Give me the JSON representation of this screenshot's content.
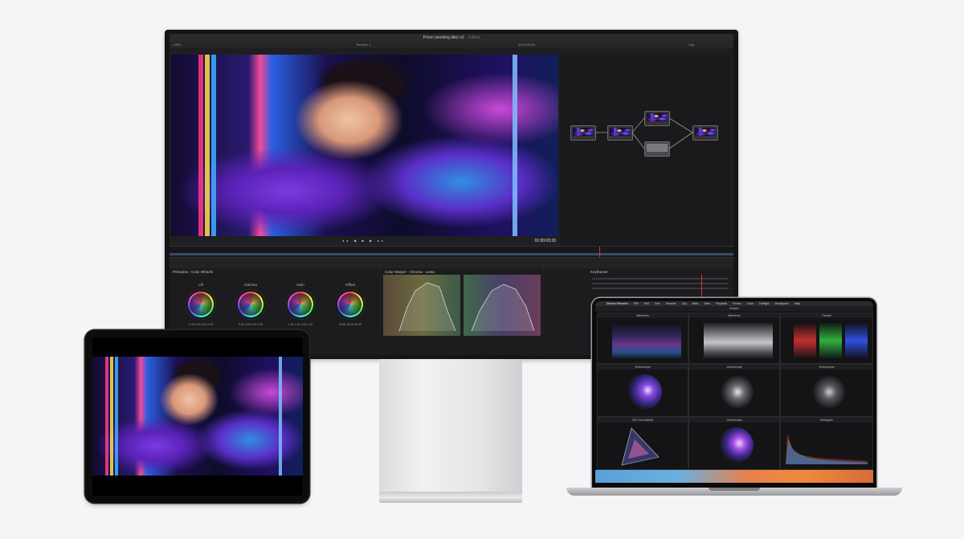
{
  "monitor": {
    "title": "Prism (working title) v3",
    "title_suffix": "Edited",
    "top_left": "CAPs",
    "timeline_label": "Timeline 1",
    "timecode": "00:00:00:00",
    "clip_label": "Clip",
    "playhead_timecode": "01:00:03:20",
    "color_wheels_title": "Primaries - Color Wheels",
    "wheels": [
      {
        "label": "Lift",
        "values": "0.00  0.00  0.00  0.00"
      },
      {
        "label": "Gamma",
        "values": "0.00  0.00  0.00  0.00"
      },
      {
        "label": "Gain",
        "values": "1.00  1.00  1.00  1.00"
      },
      {
        "label": "Offset",
        "values": "25.00  25.00  25.00"
      }
    ],
    "curves_title": "Color Warper - Chroma - Luma",
    "keyframes_title": "Keyframes"
  },
  "laptop": {
    "menu": [
      "DaVinci Resolve",
      "File",
      "Edit",
      "Trim",
      "Timeline",
      "Clip",
      "Mark",
      "View",
      "Playback",
      "Fusion",
      "Color",
      "Fairlight",
      "Workspace",
      "Help"
    ],
    "center_title": "Scopes",
    "panels": [
      {
        "title": "Waveform"
      },
      {
        "title": "Waveform"
      },
      {
        "title": "Parade"
      },
      {
        "title": "Vectorscope"
      },
      {
        "title": "Vectorscope"
      },
      {
        "title": "Vectorscope"
      },
      {
        "title": "CIE Chromaticity"
      },
      {
        "title": "Vectorscope"
      },
      {
        "title": "Histogram"
      }
    ]
  }
}
